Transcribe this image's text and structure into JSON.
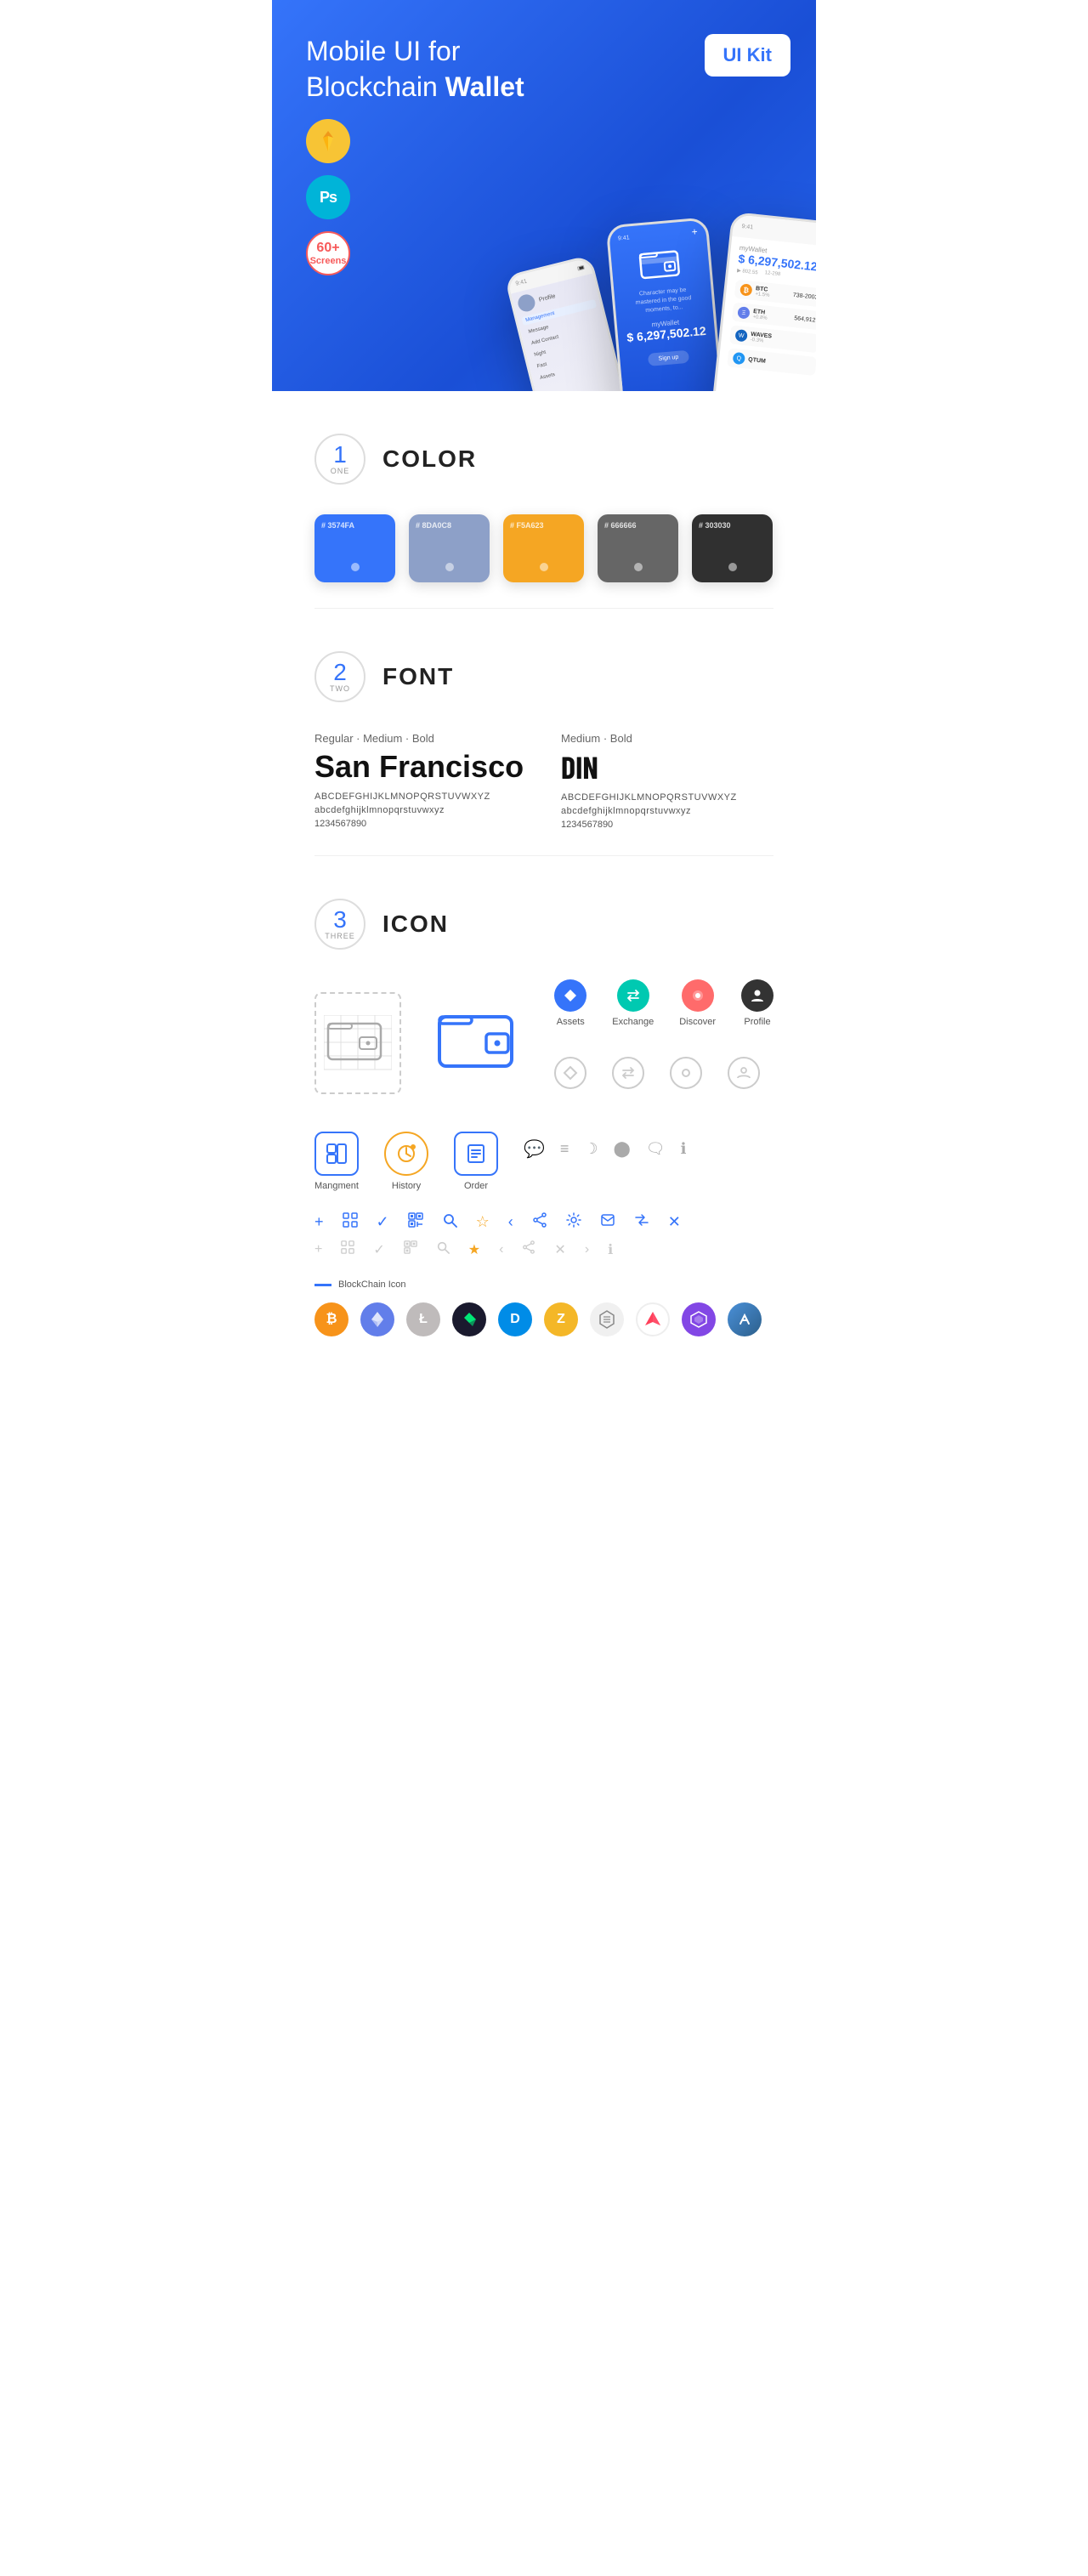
{
  "hero": {
    "title_plain": "Mobile UI for Blockchain ",
    "title_bold": "Wallet",
    "ui_kit_label": "UI Kit",
    "badge_sketch": "✦",
    "badge_ps": "Ps",
    "badge_screens_count": "60+",
    "badge_screens_label": "Screens"
  },
  "sections": {
    "color": {
      "number": "1",
      "word": "ONE",
      "title": "COLOR",
      "swatches": [
        {
          "hex": "#3574FA",
          "label": "# 3574FA",
          "name": "3574FA"
        },
        {
          "hex": "#8DA0C8",
          "label": "# 8DA0C8",
          "name": "8DA0C8"
        },
        {
          "hex": "#F5A623",
          "label": "# F5A623",
          "name": "F5A623"
        },
        {
          "hex": "#666666",
          "label": "# 666666",
          "name": "666666"
        },
        {
          "hex": "#303030",
          "label": "# 303030",
          "name": "303030"
        }
      ]
    },
    "font": {
      "number": "2",
      "word": "TWO",
      "title": "FONT",
      "font1": {
        "weight_label": "Regular · Medium · Bold",
        "name": "San Francisco",
        "uppercase": "ABCDEFGHIJKLMNOPQRSTUVWXYZ",
        "lowercase": "abcdefghijklmnopqrstuvwxyz",
        "numbers": "1234567890"
      },
      "font2": {
        "weight_label": "Medium · Bold",
        "name": "DIN",
        "uppercase": "ABCDEFGHIJKLMNOPQRSTUVWXYZ",
        "lowercase": "abcdefghijklmnopqrstuvwxyz",
        "numbers": "1234567890"
      }
    },
    "icon": {
      "number": "3",
      "word": "THREE",
      "title": "ICON",
      "nav_icons": [
        {
          "name": "Assets",
          "symbol": "◆"
        },
        {
          "name": "Exchange",
          "symbol": "⇌"
        },
        {
          "name": "Discover",
          "symbol": "●"
        },
        {
          "name": "Profile",
          "symbol": "👤"
        }
      ],
      "app_icons": [
        {
          "name": "Mangment",
          "symbol": "▣"
        },
        {
          "name": "History",
          "symbol": "⏱"
        },
        {
          "name": "Order",
          "symbol": "≡"
        }
      ],
      "tool_icons": [
        "+",
        "⊞",
        "✓",
        "⊞",
        "🔍",
        "☆",
        "‹",
        "↗",
        "⚙",
        "⊡",
        "⇔",
        "✕"
      ],
      "blockchain_label": "BlockChain Icon",
      "crypto": [
        {
          "name": "BTC",
          "symbol": "₿",
          "class": "crypto-btc"
        },
        {
          "name": "ETH",
          "symbol": "⬡",
          "class": "crypto-eth"
        },
        {
          "name": "LTC",
          "symbol": "Ł",
          "class": "crypto-ltc"
        },
        {
          "name": "NEO",
          "symbol": "⬟",
          "class": "crypto-neo"
        },
        {
          "name": "DASH",
          "symbol": "D",
          "class": "crypto-dash"
        },
        {
          "name": "ZEC",
          "symbol": "Z",
          "class": "crypto-z"
        },
        {
          "name": "IOTA",
          "symbol": "◉",
          "class": "crypto-iota"
        },
        {
          "name": "ARK",
          "symbol": "▲",
          "class": "crypto-ark"
        },
        {
          "name": "MATIC",
          "symbol": "M",
          "class": "crypto-matic"
        },
        {
          "name": "NANO",
          "symbol": "◎",
          "class": "crypto-nano"
        }
      ]
    }
  }
}
